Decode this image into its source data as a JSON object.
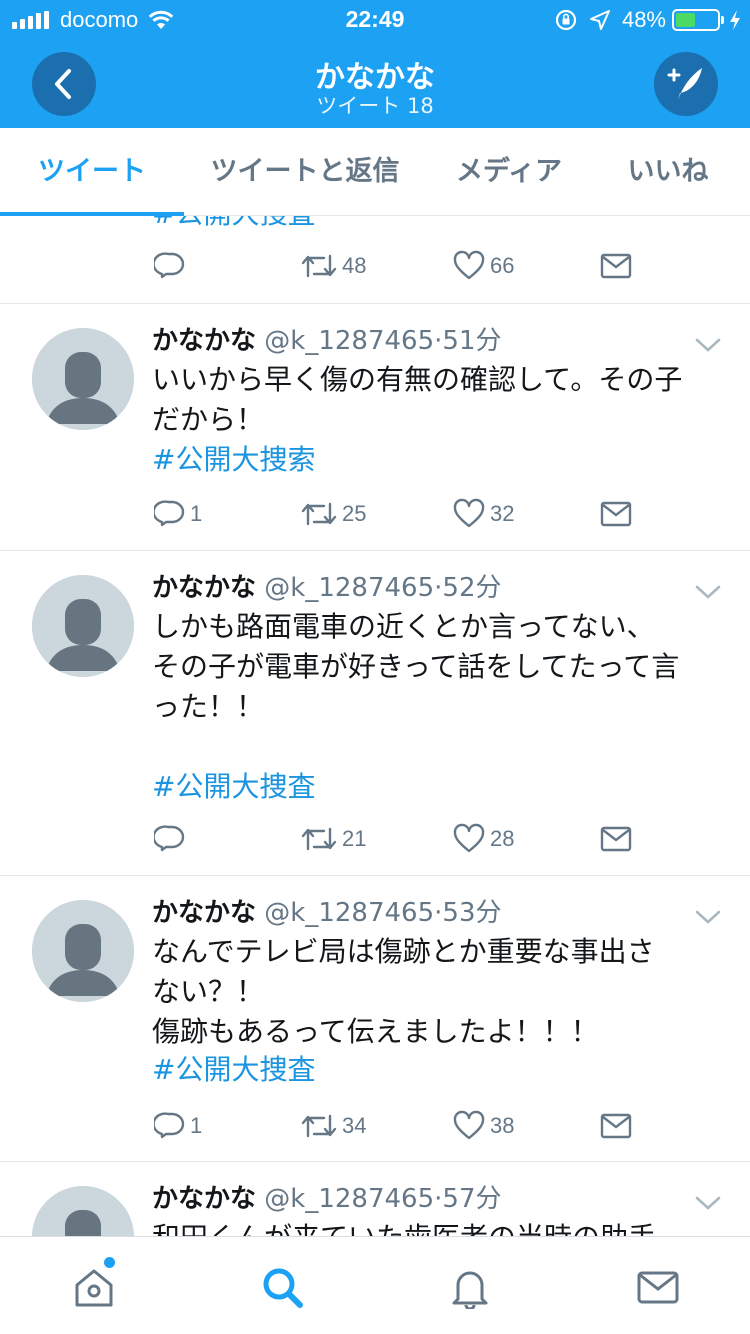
{
  "status_bar": {
    "carrier": "docomo",
    "time": "22:49",
    "battery_percent": "48%",
    "battery_level": 0.48,
    "battery_color": "#4cd964"
  },
  "header": {
    "title": "かなかな",
    "subtitle": "ツイート 18",
    "back_icon": "chevron-left-icon",
    "compose_icon": "compose-tweet-icon",
    "bar_color": "#1da1f2"
  },
  "tabs": [
    {
      "label": "ツイート",
      "active": true
    },
    {
      "label": "ツイートと返信",
      "active": false
    },
    {
      "label": "メディア",
      "active": false
    },
    {
      "label": "いいね",
      "active": false
    }
  ],
  "partial_tweet": {
    "cut_text": "#公開大捜査",
    "reply_count": "",
    "retweet_count": "48",
    "like_count": "66"
  },
  "tweets": [
    {
      "name": "かなかな",
      "handle": "@k_1287465",
      "separator": "·",
      "time": "51分",
      "text": "いいから早く傷の有無の確認して。その子\nだから！",
      "hashtag": "#公開大捜索",
      "reply_count": "1",
      "retweet_count": "25",
      "like_count": "32"
    },
    {
      "name": "かなかな",
      "handle": "@k_1287465",
      "separator": "·",
      "time": "52分",
      "text": "しかも路面電車の近くとか言ってない、\nその子が電車が好きって話をしてたって言\nった！！\n",
      "hashtag": "#公開大捜査",
      "reply_count": "",
      "retweet_count": "21",
      "like_count": "28"
    },
    {
      "name": "かなかな",
      "handle": "@k_1287465",
      "separator": "·",
      "time": "53分",
      "text": "なんでテレビ局は傷跡とか重要な事出さ\nない？！\n傷跡もあるって伝えましたよ！！！",
      "hashtag": "#公開大捜査",
      "reply_count": "1",
      "retweet_count": "34",
      "like_count": "38"
    },
    {
      "name": "かなかな",
      "handle": "@k_1287465",
      "separator": "·",
      "time": "57分",
      "text": "和田くんが来ていた歯医者の当時の助手",
      "hashtag": "",
      "reply_count": "",
      "retweet_count": "",
      "like_count": ""
    }
  ],
  "bottom_nav": [
    {
      "icon": "home-icon",
      "active": false,
      "has_notification_dot": true
    },
    {
      "icon": "search-icon",
      "active": true
    },
    {
      "icon": "notifications-bell-icon",
      "active": false
    },
    {
      "icon": "messages-envelope-icon",
      "active": false
    }
  ],
  "colors": {
    "accent": "#1da1f2",
    "hashtag": "#1b95e0",
    "secondary_text": "#657786",
    "divider": "#e1e8ed"
  }
}
